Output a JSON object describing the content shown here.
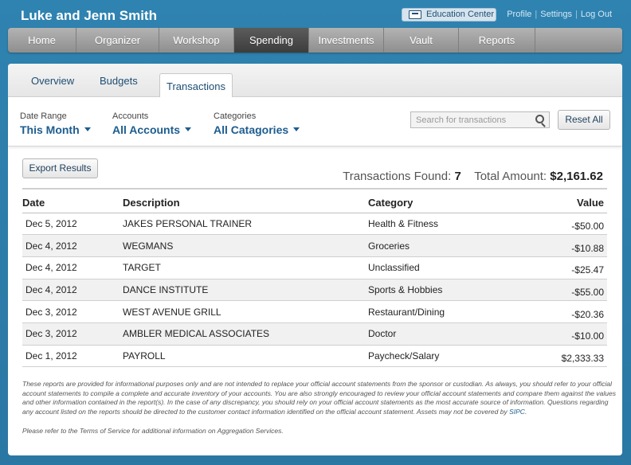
{
  "header": {
    "user_name": "Luke and Jenn Smith",
    "education_center": "Education Center",
    "links": [
      "Profile",
      "Settings",
      "Log Out"
    ]
  },
  "mainnav": {
    "active": "Spending",
    "items": [
      "Home",
      "Organizer",
      "Workshop",
      "Spending",
      "Investments",
      "Vault",
      "Reports"
    ]
  },
  "subtabs": {
    "active": "Transactions",
    "items": [
      "Overview",
      "Budgets",
      "Transactions"
    ]
  },
  "filters": {
    "date_range": {
      "label": "Date Range",
      "value": "This Month"
    },
    "accounts": {
      "label": "Accounts",
      "value": "All Accounts"
    },
    "categories": {
      "label": "Categories",
      "value": "All Catagories"
    },
    "search_placeholder": "Search for transactions",
    "reset_label": "Reset All"
  },
  "export_label": "Export Results",
  "summary": {
    "found_label": "Transactions Found:",
    "found_count": "7",
    "total_label": "Total Amount:",
    "total_value": "$2,161.62"
  },
  "table": {
    "headers": [
      "Date",
      "Description",
      "Category",
      "Value"
    ],
    "rows": [
      {
        "date": "Dec 5, 2012",
        "description": "JAKES PERSONAL TRAINER",
        "category": "Health & Fitness",
        "value": "-$50.00"
      },
      {
        "date": "Dec 4, 2012",
        "description": "WEGMANS",
        "category": "Groceries",
        "value": "-$10.88"
      },
      {
        "date": "Dec 4, 2012",
        "description": "TARGET",
        "category": "Unclassified",
        "value": "-$25.47"
      },
      {
        "date": "Dec 4, 2012",
        "description": "DANCE INSTITUTE",
        "category": "Sports & Hobbies",
        "value": "-$55.00"
      },
      {
        "date": "Dec 3, 2012",
        "description": "WEST AVENUE GRILL",
        "category": "Restaurant/Dining",
        "value": "-$20.36"
      },
      {
        "date": "Dec 3, 2012",
        "description": "AMBLER MEDICAL ASSOCIATES",
        "category": "Doctor",
        "value": "-$10.00"
      },
      {
        "date": "Dec 1, 2012",
        "description": "PAYROLL",
        "category": "Paycheck/Salary",
        "value": "$2,333.33"
      }
    ]
  },
  "disclaimer": {
    "text": "These reports are provided for informational purposes only and are not intended to replace your official account statements from the sponsor or custodian. As always, you should refer to your official account statements to compile a complete and accurate inventory of your accounts. You are also strongly encouraged to review your official account statements and compare them against the values and other information contained in the report(s). In the case of any discrepancy, you should rely on your official account statements as the most accurate source of information. Questions regarding any account listed on the reports should be directed to the customer contact information identified on the official account statement. Assets may not be covered by",
    "link": "SIPC",
    "tos": "Please refer to the Terms of Service for additional information on Aggregation Services."
  },
  "colors": {
    "background": "#2c7ba8",
    "nav_active": "#4a4a4a",
    "link_blue": "#1d5d8f"
  }
}
